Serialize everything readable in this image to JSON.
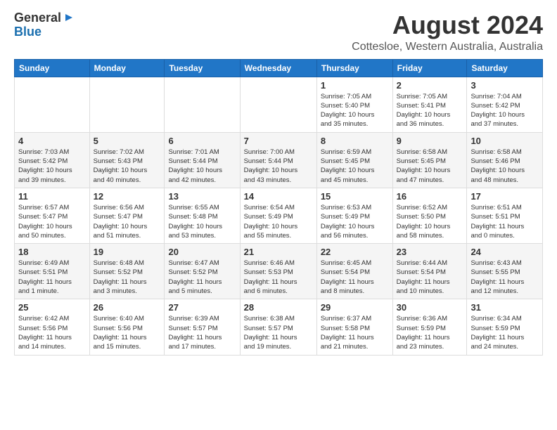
{
  "logo": {
    "general": "General",
    "blue": "Blue"
  },
  "header": {
    "title": "August 2024",
    "subtitle": "Cottesloe, Western Australia, Australia"
  },
  "days_of_week": [
    "Sunday",
    "Monday",
    "Tuesday",
    "Wednesday",
    "Thursday",
    "Friday",
    "Saturday"
  ],
  "weeks": [
    [
      {
        "day": "",
        "info": ""
      },
      {
        "day": "",
        "info": ""
      },
      {
        "day": "",
        "info": ""
      },
      {
        "day": "",
        "info": ""
      },
      {
        "day": "1",
        "info": "Sunrise: 7:05 AM\nSunset: 5:40 PM\nDaylight: 10 hours\nand 35 minutes."
      },
      {
        "day": "2",
        "info": "Sunrise: 7:05 AM\nSunset: 5:41 PM\nDaylight: 10 hours\nand 36 minutes."
      },
      {
        "day": "3",
        "info": "Sunrise: 7:04 AM\nSunset: 5:42 PM\nDaylight: 10 hours\nand 37 minutes."
      }
    ],
    [
      {
        "day": "4",
        "info": "Sunrise: 7:03 AM\nSunset: 5:42 PM\nDaylight: 10 hours\nand 39 minutes."
      },
      {
        "day": "5",
        "info": "Sunrise: 7:02 AM\nSunset: 5:43 PM\nDaylight: 10 hours\nand 40 minutes."
      },
      {
        "day": "6",
        "info": "Sunrise: 7:01 AM\nSunset: 5:44 PM\nDaylight: 10 hours\nand 42 minutes."
      },
      {
        "day": "7",
        "info": "Sunrise: 7:00 AM\nSunset: 5:44 PM\nDaylight: 10 hours\nand 43 minutes."
      },
      {
        "day": "8",
        "info": "Sunrise: 6:59 AM\nSunset: 5:45 PM\nDaylight: 10 hours\nand 45 minutes."
      },
      {
        "day": "9",
        "info": "Sunrise: 6:58 AM\nSunset: 5:45 PM\nDaylight: 10 hours\nand 47 minutes."
      },
      {
        "day": "10",
        "info": "Sunrise: 6:58 AM\nSunset: 5:46 PM\nDaylight: 10 hours\nand 48 minutes."
      }
    ],
    [
      {
        "day": "11",
        "info": "Sunrise: 6:57 AM\nSunset: 5:47 PM\nDaylight: 10 hours\nand 50 minutes."
      },
      {
        "day": "12",
        "info": "Sunrise: 6:56 AM\nSunset: 5:47 PM\nDaylight: 10 hours\nand 51 minutes."
      },
      {
        "day": "13",
        "info": "Sunrise: 6:55 AM\nSunset: 5:48 PM\nDaylight: 10 hours\nand 53 minutes."
      },
      {
        "day": "14",
        "info": "Sunrise: 6:54 AM\nSunset: 5:49 PM\nDaylight: 10 hours\nand 55 minutes."
      },
      {
        "day": "15",
        "info": "Sunrise: 6:53 AM\nSunset: 5:49 PM\nDaylight: 10 hours\nand 56 minutes."
      },
      {
        "day": "16",
        "info": "Sunrise: 6:52 AM\nSunset: 5:50 PM\nDaylight: 10 hours\nand 58 minutes."
      },
      {
        "day": "17",
        "info": "Sunrise: 6:51 AM\nSunset: 5:51 PM\nDaylight: 11 hours\nand 0 minutes."
      }
    ],
    [
      {
        "day": "18",
        "info": "Sunrise: 6:49 AM\nSunset: 5:51 PM\nDaylight: 11 hours\nand 1 minute."
      },
      {
        "day": "19",
        "info": "Sunrise: 6:48 AM\nSunset: 5:52 PM\nDaylight: 11 hours\nand 3 minutes."
      },
      {
        "day": "20",
        "info": "Sunrise: 6:47 AM\nSunset: 5:52 PM\nDaylight: 11 hours\nand 5 minutes."
      },
      {
        "day": "21",
        "info": "Sunrise: 6:46 AM\nSunset: 5:53 PM\nDaylight: 11 hours\nand 6 minutes."
      },
      {
        "day": "22",
        "info": "Sunrise: 6:45 AM\nSunset: 5:54 PM\nDaylight: 11 hours\nand 8 minutes."
      },
      {
        "day": "23",
        "info": "Sunrise: 6:44 AM\nSunset: 5:54 PM\nDaylight: 11 hours\nand 10 minutes."
      },
      {
        "day": "24",
        "info": "Sunrise: 6:43 AM\nSunset: 5:55 PM\nDaylight: 11 hours\nand 12 minutes."
      }
    ],
    [
      {
        "day": "25",
        "info": "Sunrise: 6:42 AM\nSunset: 5:56 PM\nDaylight: 11 hours\nand 14 minutes."
      },
      {
        "day": "26",
        "info": "Sunrise: 6:40 AM\nSunset: 5:56 PM\nDaylight: 11 hours\nand 15 minutes."
      },
      {
        "day": "27",
        "info": "Sunrise: 6:39 AM\nSunset: 5:57 PM\nDaylight: 11 hours\nand 17 minutes."
      },
      {
        "day": "28",
        "info": "Sunrise: 6:38 AM\nSunset: 5:57 PM\nDaylight: 11 hours\nand 19 minutes."
      },
      {
        "day": "29",
        "info": "Sunrise: 6:37 AM\nSunset: 5:58 PM\nDaylight: 11 hours\nand 21 minutes."
      },
      {
        "day": "30",
        "info": "Sunrise: 6:36 AM\nSunset: 5:59 PM\nDaylight: 11 hours\nand 23 minutes."
      },
      {
        "day": "31",
        "info": "Sunrise: 6:34 AM\nSunset: 5:59 PM\nDaylight: 11 hours\nand 24 minutes."
      }
    ]
  ]
}
